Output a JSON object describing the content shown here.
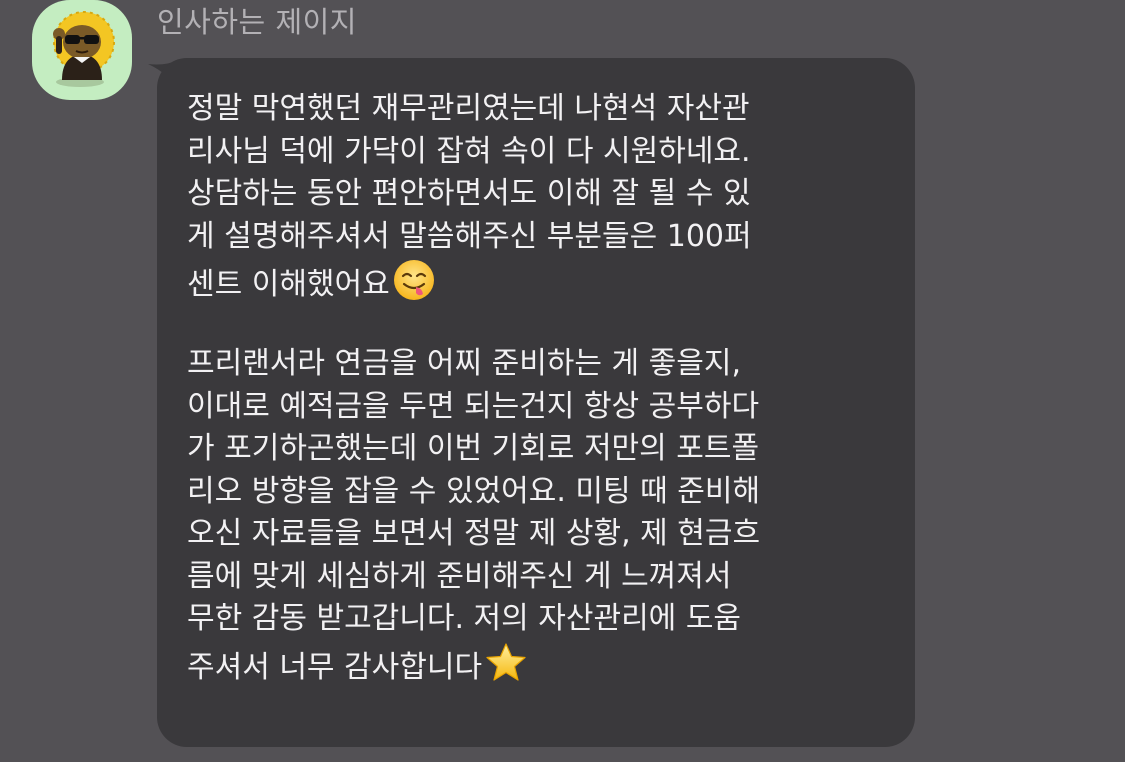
{
  "chat": {
    "sender": {
      "name": "인사하는 제이지",
      "avatar": "character-avatar-icon"
    },
    "message": {
      "paragraph1": [
        "정말 막연했던 재무관리였는데 나현석 자산관",
        "리사님 덕에 가닥이 잡혀 속이 다 시원하네요.",
        "상담하는 동안 편안하면서도 이해 잘 될 수 있",
        "게 설명해주셔서 말씀해주신 부분들은 100퍼",
        "센트 이해했어요"
      ],
      "paragraph2": [
        "프리랜서라 연금을 어찌 준비하는 게 좋을지,",
        "이대로 예적금을 두면 되는건지 항상 공부하다",
        "가 포기하곤했는데 이번 기회로 저만의 포트폴",
        "리오 방향을 잡을 수 있었어요. 미팅 때 준비해",
        "오신 자료들을 보면서 정말 제 상황, 제 현금흐",
        "름에 맞게 세심하게 준비해주신 게 느껴져서",
        "무한 감동 받고갑니다. 저의 자산관리에 도움",
        "주셔서 너무 감사합니다"
      ],
      "emoji1": "yum-face-icon",
      "emoji2": "star-icon"
    }
  },
  "colors": {
    "background": "#535155",
    "bubble": "#3a393c",
    "text": "#f2f1f3",
    "sender_name": "#b3b1b5",
    "avatar_bg": "#c4edc1"
  }
}
